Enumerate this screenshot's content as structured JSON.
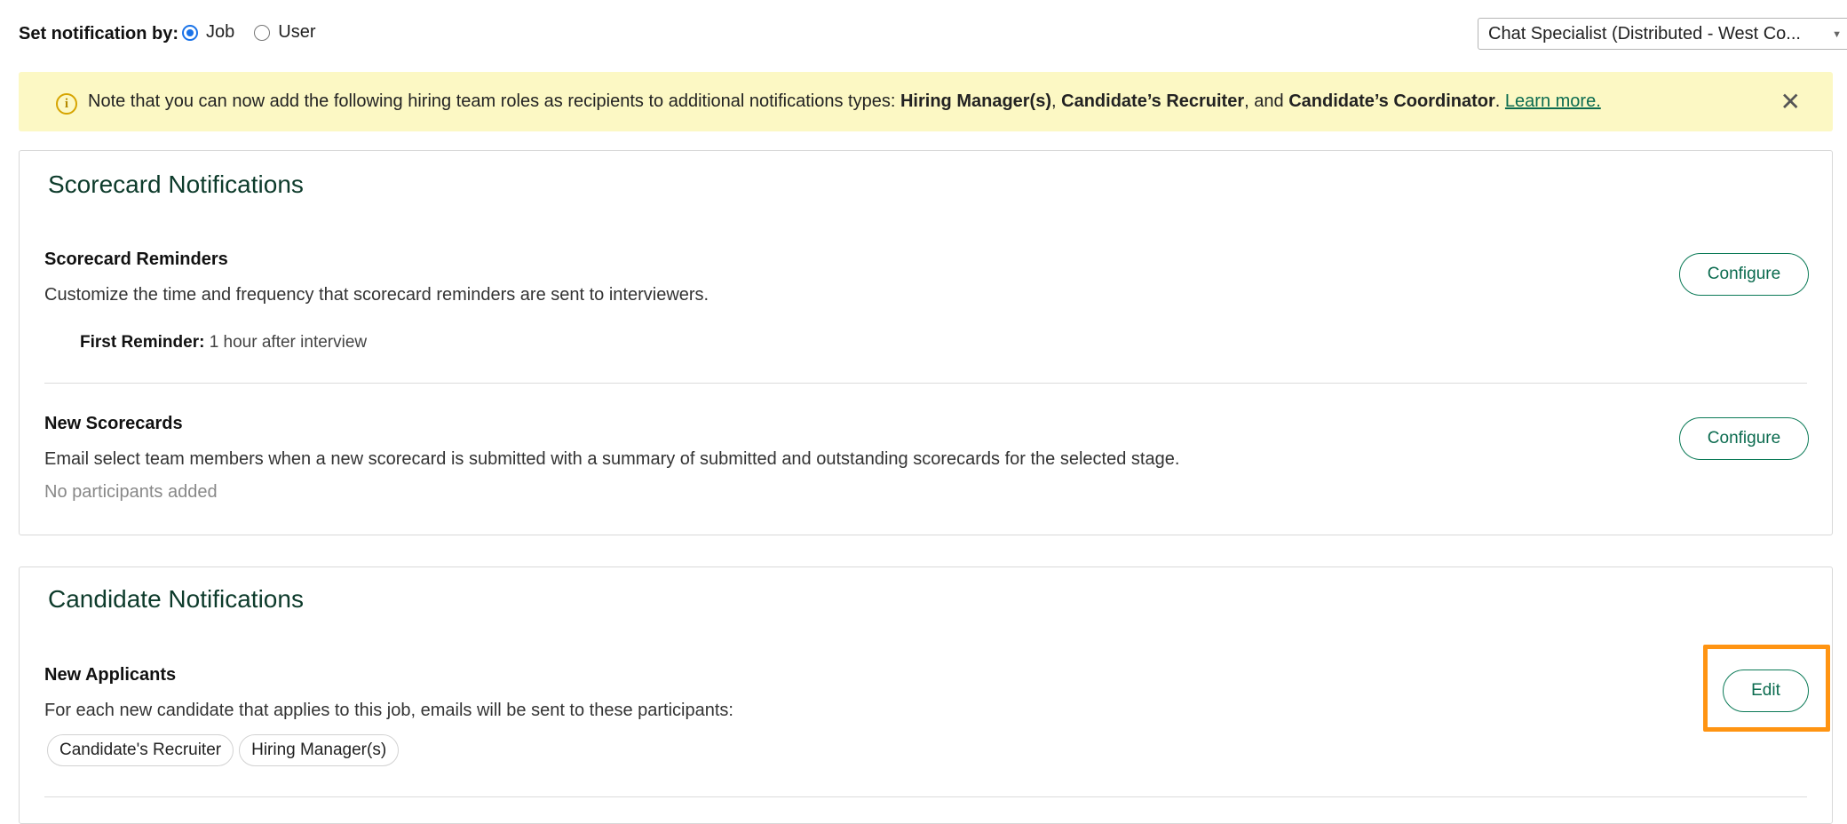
{
  "topbar": {
    "label": "Set notification by:",
    "options": [
      {
        "label": "Job",
        "selected": true
      },
      {
        "label": "User",
        "selected": false
      }
    ],
    "job_select": "Chat Specialist (Distributed - West Co..."
  },
  "note": {
    "prefix": "Note that you can now add the following hiring team roles as recipients to additional notifications types: ",
    "role1": "Hiring Manager(s)",
    "sep1": ", ",
    "role2": "Candidate’s Recruiter",
    "sep2": ", and ",
    "role3": "Candidate’s Coordinator",
    "period": ". ",
    "link": "Learn more.",
    "close_icon": "close-icon",
    "info_icon": "info-icon"
  },
  "scorecard": {
    "title": "Scorecard Notifications",
    "reminders": {
      "title": "Scorecard Reminders",
      "desc": "Customize the time and frequency that scorecard reminders are sent to interviewers.",
      "detail_label": "First Reminder:",
      "detail_value": " 1 hour after interview",
      "button": "Configure"
    },
    "new_scorecards": {
      "title": "New Scorecards",
      "desc": "Email select team members when a new scorecard is submitted with a summary of submitted and outstanding scorecards for the selected stage.",
      "empty": "No participants added",
      "button": "Configure"
    }
  },
  "candidate": {
    "title": "Candidate Notifications",
    "new_applicants": {
      "title": "New Applicants",
      "desc": "For each new candidate that applies to this job, emails will be sent to these participants:",
      "chips": [
        "Candidate's Recruiter",
        "Hiring Manager(s)"
      ],
      "button": "Edit"
    }
  },
  "colors": {
    "accent_green": "#0b6b4f",
    "note_bg": "#fcf8c4",
    "highlight": "#ff9412",
    "radio_blue": "#1a73e8"
  }
}
